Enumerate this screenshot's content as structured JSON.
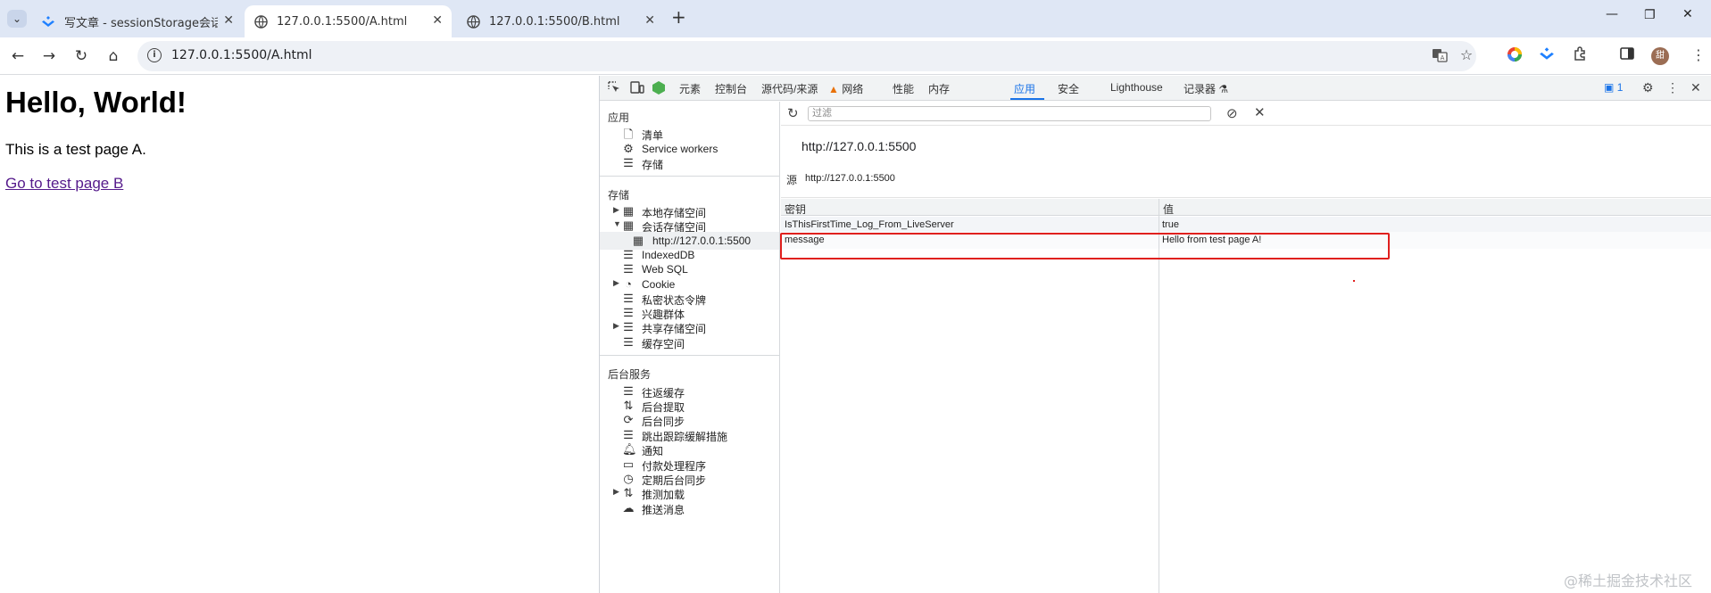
{
  "browser": {
    "tabs": [
      {
        "title": "写文章 - sessionStorage会话",
        "favicon": "juejin-icon"
      },
      {
        "title": "127.0.0.1:5500/A.html",
        "favicon": "globe-icon",
        "active": true
      },
      {
        "title": "127.0.0.1:5500/B.html",
        "favicon": "globe-icon"
      }
    ],
    "address": "127.0.0.1:5500/A.html",
    "avatar_letter": "甜"
  },
  "page": {
    "heading": "Hello, World!",
    "text": "This is a test page A.",
    "link": "Go to test page B"
  },
  "devtools": {
    "tabs": [
      "元素",
      "控制台",
      "源代码/来源",
      "网络",
      "性能",
      "内存",
      "应用",
      "安全",
      "Lighthouse",
      "记录器"
    ],
    "active_tab": "应用",
    "issues_count": "1",
    "sidebar": {
      "section_app": "应用",
      "app_items": [
        "清单",
        "Service workers",
        "存储"
      ],
      "section_storage": "存储",
      "storage_items": [
        "本地存储空间",
        "会话存储空间",
        "http://127.0.0.1:5500",
        "IndexedDB",
        "Web SQL",
        "Cookie",
        "私密状态令牌",
        "兴趣群体",
        "共享存储空间",
        "缓存空间"
      ],
      "section_bg": "后台服务",
      "bg_items": [
        "往返缓存",
        "后台提取",
        "后台同步",
        "跳出跟踪缓解措施",
        "通知",
        "付款处理程序",
        "定期后台同步",
        "推测加载",
        "推送消息"
      ]
    },
    "filter_placeholder": "过滤",
    "origin_title": "http://127.0.0.1:5500",
    "origin_label": "源",
    "origin_value": "http://127.0.0.1:5500",
    "table": {
      "headers": [
        "密钥",
        "值"
      ],
      "rows": [
        {
          "key": "IsThisFirstTime_Log_From_LiveServer",
          "value": "true"
        },
        {
          "key": "message",
          "value": "Hello from test page A!"
        }
      ]
    }
  },
  "watermark": "@稀土掘金技术社区",
  "colors": {
    "accent": "#1a73e8",
    "highlight": "#e0201e",
    "tabstrip": "#dfe7f5"
  }
}
